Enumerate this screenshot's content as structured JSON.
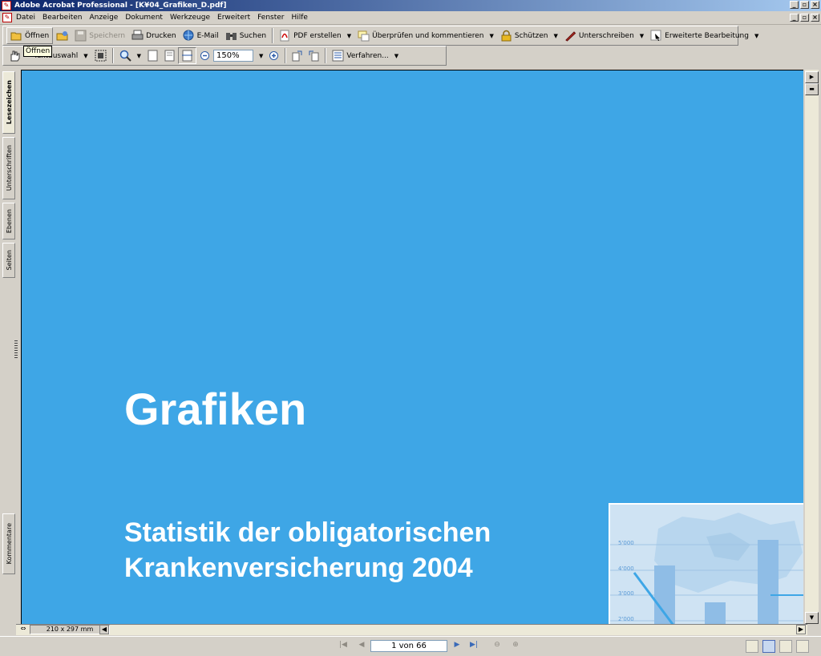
{
  "window": {
    "title": "Adobe Acrobat Professional - [K¥04_Grafiken_D.pdf]"
  },
  "menu": [
    "Datei",
    "Bearbeiten",
    "Anzeige",
    "Dokument",
    "Werkzeuge",
    "Erweitert",
    "Fenster",
    "Hilfe"
  ],
  "toolbar1": {
    "open": "Öffnen",
    "save": "Speichern",
    "print": "Drucken",
    "email": "E-Mail",
    "search": "Suchen",
    "create_pdf": "PDF erstellen",
    "review": "Überprüfen und kommentieren",
    "secure": "Schützen",
    "sign": "Unterschreiben",
    "advanced_editing": "Erweiterte Bearbeitung"
  },
  "toolbar2": {
    "text_select": "Textauswahl",
    "zoom_value": "150%",
    "procedures": "Verfahren..."
  },
  "tooltip": "Öffnen",
  "side_tabs": {
    "bookmarks": "Lesezeichen",
    "signatures": "Unterschriften",
    "layers": "Ebenen",
    "pages": "Seiten",
    "comments": "Kommentare"
  },
  "document": {
    "title": "Grafiken",
    "subtitle_line1": "Statistik der obligatorischen",
    "subtitle_line2": "Krankenversicherung 2004",
    "chart_ticks": [
      "5'000",
      "4'000",
      "3'000",
      "2'000"
    ]
  },
  "status": {
    "page_size": "210 x 297 mm",
    "page_indicator": "1 von 66"
  }
}
